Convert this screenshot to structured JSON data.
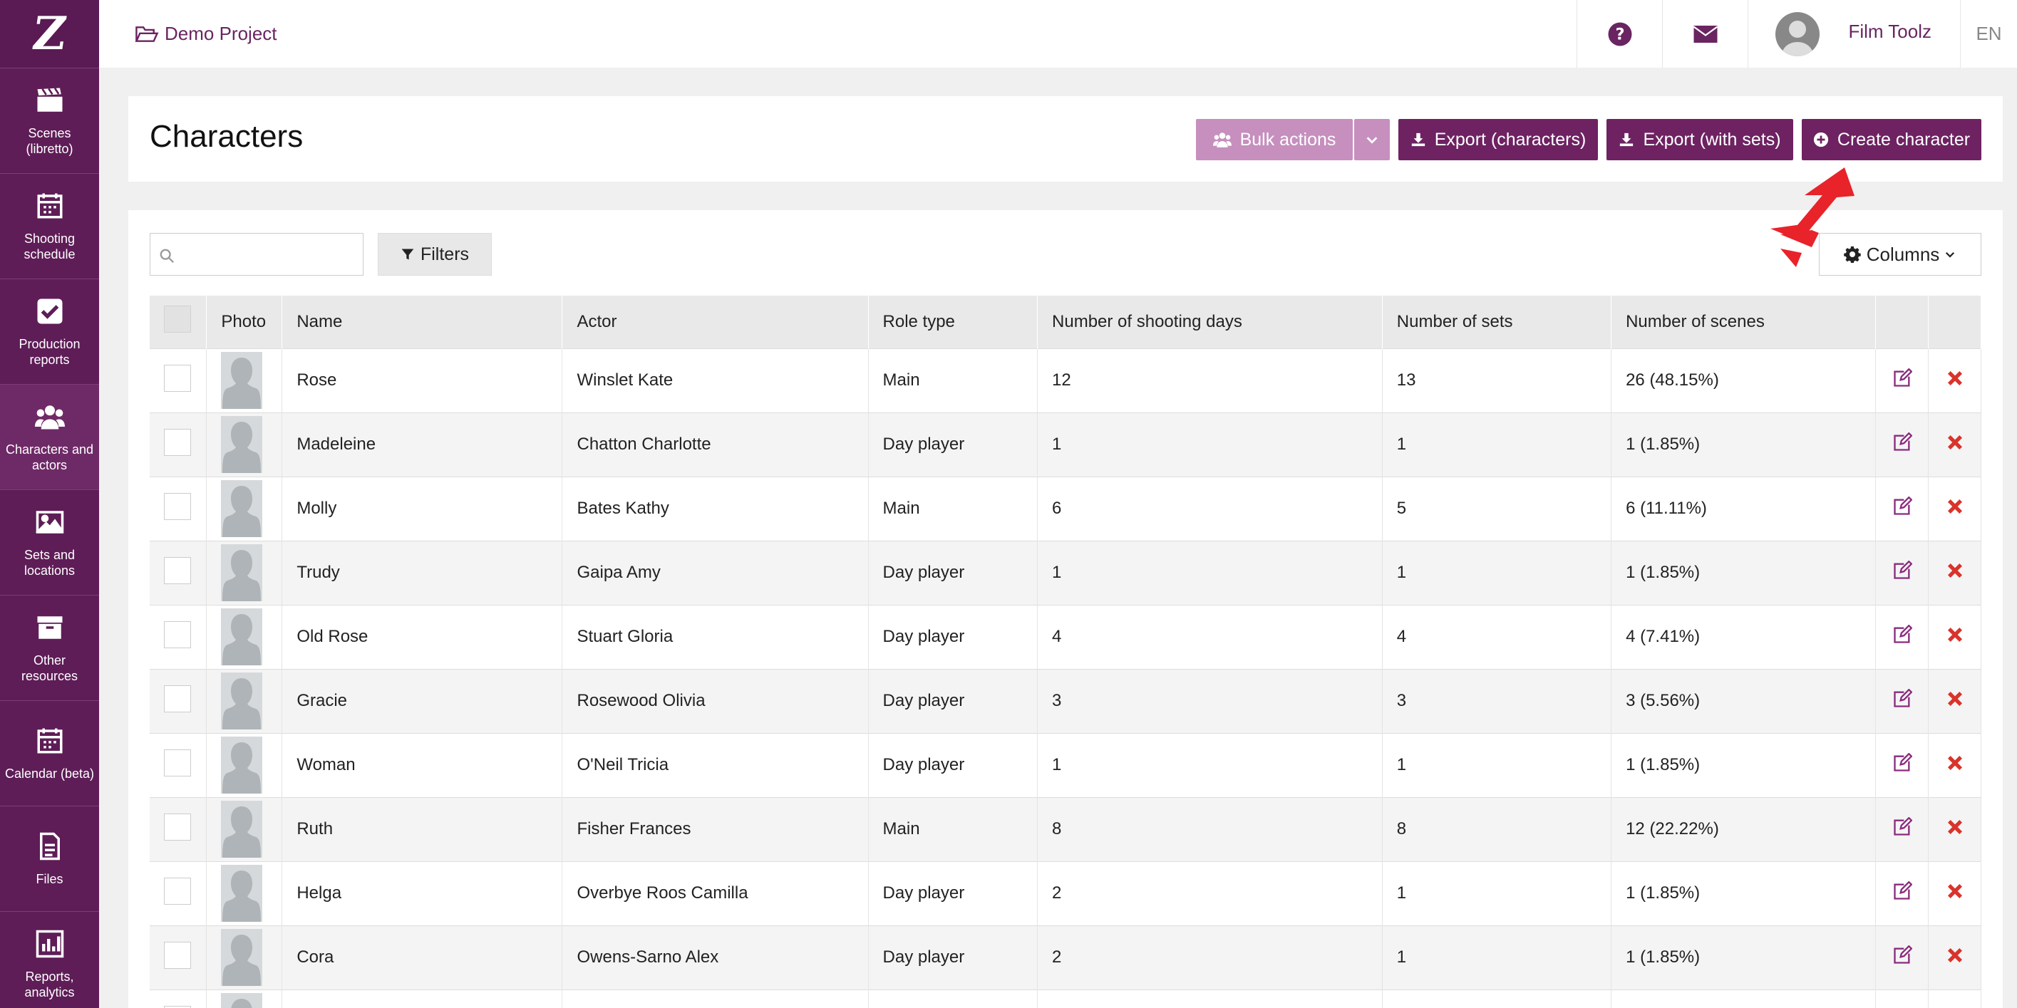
{
  "topbar": {
    "project": "Demo Project",
    "user_name": "Film Toolz",
    "lang": "EN"
  },
  "sidebar": {
    "logo": "Z",
    "items": [
      {
        "label": "Scenes (libretto)",
        "icon": "clapperboard-icon"
      },
      {
        "label": "Shooting schedule",
        "icon": "calendar-icon"
      },
      {
        "label": "Production reports",
        "icon": "check-square-icon"
      },
      {
        "label": "Characters and actors",
        "icon": "users-icon"
      },
      {
        "label": "Sets and locations",
        "icon": "image-icon"
      },
      {
        "label": "Other resources",
        "icon": "archive-icon"
      },
      {
        "label": "Calendar (beta)",
        "icon": "calendar-icon"
      },
      {
        "label": "Files",
        "icon": "file-icon"
      },
      {
        "label": "Reports, analytics",
        "icon": "bar-chart-icon"
      }
    ]
  },
  "header": {
    "title": "Characters",
    "bulk_actions": "Bulk actions",
    "export_characters": "Export (characters)",
    "export_with_sets": "Export (with sets)",
    "create_character": "Create character"
  },
  "toolbar": {
    "search_placeholder": "",
    "filters": "Filters",
    "columns": "Columns"
  },
  "table": {
    "columns": [
      "Photo",
      "Name",
      "Actor",
      "Role type",
      "Number of shooting days",
      "Number of sets",
      "Number of scenes"
    ],
    "rows": [
      {
        "name": "Rose",
        "actor": "Winslet Kate",
        "role": "Main",
        "days": "12",
        "sets": "13",
        "scenes": "26 (48.15%)"
      },
      {
        "name": "Madeleine",
        "actor": "Chatton Charlotte",
        "role": "Day player",
        "days": "1",
        "sets": "1",
        "scenes": "1 (1.85%)"
      },
      {
        "name": "Molly",
        "actor": "Bates Kathy",
        "role": "Main",
        "days": "6",
        "sets": "5",
        "scenes": "6 (11.11%)"
      },
      {
        "name": "Trudy",
        "actor": "Gaipa Amy",
        "role": "Day player",
        "days": "1",
        "sets": "1",
        "scenes": "1 (1.85%)"
      },
      {
        "name": "Old Rose",
        "actor": "Stuart Gloria",
        "role": "Day player",
        "days": "4",
        "sets": "4",
        "scenes": "4 (7.41%)"
      },
      {
        "name": "Gracie",
        "actor": "Rosewood Olivia",
        "role": "Day player",
        "days": "3",
        "sets": "3",
        "scenes": "3 (5.56%)"
      },
      {
        "name": "Woman",
        "actor": "O'Neil Tricia",
        "role": "Day player",
        "days": "1",
        "sets": "1",
        "scenes": "1 (1.85%)"
      },
      {
        "name": "Ruth",
        "actor": "Fisher Frances",
        "role": "Main",
        "days": "8",
        "sets": "8",
        "scenes": "12 (22.22%)"
      },
      {
        "name": "Helga",
        "actor": "Overbye Roos Camilla",
        "role": "Day player",
        "days": "2",
        "sets": "1",
        "scenes": "1 (1.85%)"
      },
      {
        "name": "Cora",
        "actor": "Owens-Sarno Alex",
        "role": "Day player",
        "days": "2",
        "sets": "1",
        "scenes": "1 (1.85%)"
      },
      {
        "name": "",
        "actor": "",
        "role": "",
        "days": "",
        "sets": "",
        "scenes": ""
      }
    ]
  },
  "colors": {
    "brand": "#5e1d57",
    "accent_text": "#6a2462",
    "button": "#6e2262",
    "button_disabled": "#c68fbe",
    "delete": "#d9342b"
  }
}
